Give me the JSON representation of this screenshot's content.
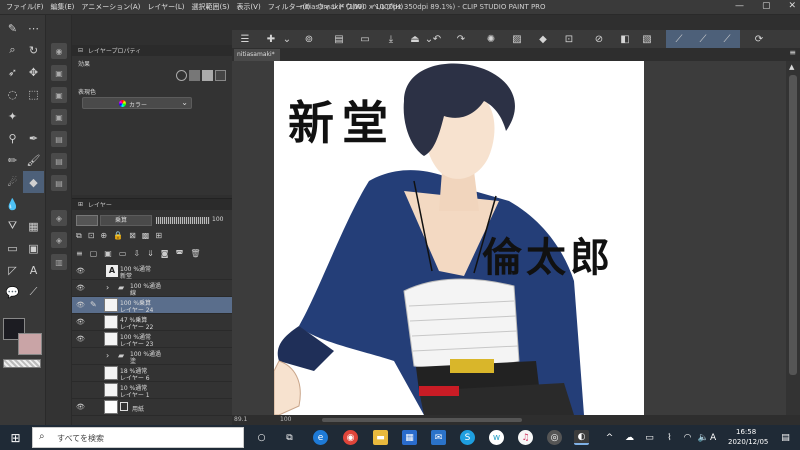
{
  "titlebar": {
    "menus": [
      "ファイル(F)",
      "編集(E)",
      "アニメーション(A)",
      "レイヤー(L)",
      "選択範囲(S)",
      "表示(V)",
      "フィルター(I)",
      "ウィンドウ(W)",
      "ヘルプ(H)"
    ],
    "app_title": "nitiasamaki* (1000 x 1000px 350dpi 89.1%) - CLIP STUDIO PAINT PRO",
    "minimize": "—",
    "maximize": "▢",
    "close": "✕"
  },
  "property_panel": {
    "tab_label": "レイヤープロパティ",
    "effect_label": "効果",
    "expression_label": "表現色",
    "expression_value": "カラー"
  },
  "layer_panel": {
    "tab_label": "レイヤー",
    "blend_mode": "乗算",
    "opacity": "100",
    "layers": [
      {
        "line1": "100 %通常",
        "line2": "新堂",
        "type": "text",
        "selected": false
      },
      {
        "line1": "100 %通過",
        "line2": "線",
        "type": "folder",
        "selected": false
      },
      {
        "line1": "100 %乗算",
        "line2": "レイヤー 24",
        "type": "raster",
        "selected": true
      },
      {
        "line1": "47 %乗算",
        "line2": "レイヤー 22",
        "type": "raster",
        "selected": false
      },
      {
        "line1": "100 %通常",
        "line2": "レイヤー 23",
        "type": "raster",
        "selected": false
      },
      {
        "line1": "100 %通過",
        "line2": "塗",
        "type": "folder",
        "selected": false
      },
      {
        "line1": "18 %通常",
        "line2": "レイヤー 6",
        "type": "raster",
        "selected": false
      },
      {
        "line1": "10 %通常",
        "line2": "レイヤー 1",
        "type": "raster",
        "selected": false
      },
      {
        "line1": "",
        "line2": "用紙",
        "type": "paper",
        "selected": false
      }
    ]
  },
  "canvas": {
    "tab_label": "nitiasamaki*",
    "text_top": "新堂",
    "text_side": "倫太郎"
  },
  "statusbar": {
    "zoom": "89.1",
    "angle": "100"
  },
  "taskbar": {
    "search_placeholder": "すべてを検索",
    "ime_label": "A",
    "time": "16:58",
    "date": "2020/12/05"
  },
  "colors": {
    "accent_selection": "#5a6e8c",
    "main_color": "#1c1c22",
    "sub_color": "#c9a4a6",
    "taskbar": "#1f2a36"
  }
}
